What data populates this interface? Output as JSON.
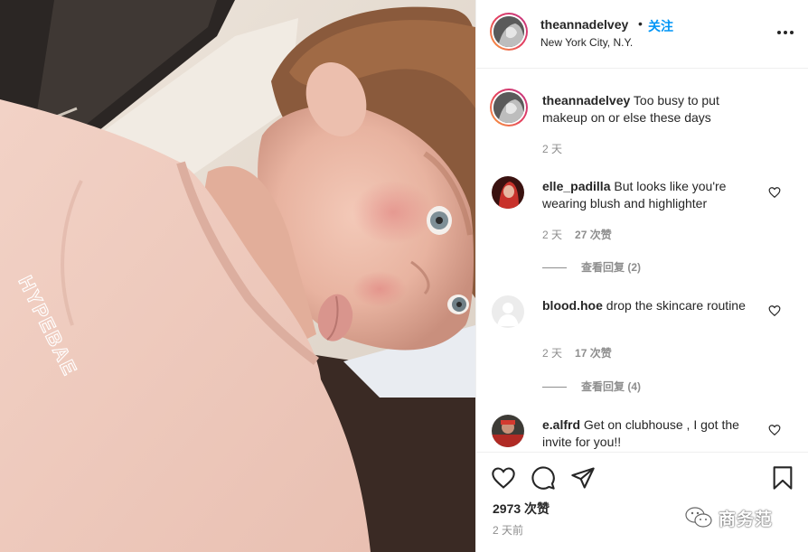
{
  "post": {
    "username": "theannadelvey",
    "separator": "•",
    "follow_label": "关注",
    "location": "New York City, N.Y.",
    "more_icon": "more-horizontal-icon",
    "shirt_text": "HYPEBAE"
  },
  "caption": {
    "username": "theannadelvey",
    "text": "Too busy to put makeup on or else these days",
    "time": "2 天"
  },
  "comments": [
    {
      "username": "elle_padilla",
      "text": "But looks like you're wearing blush and highlighter",
      "time": "2 天",
      "likes": "27 次赞",
      "replies": "查看回复 (2)"
    },
    {
      "username": "blood.hoe",
      "text": "drop the skincare routine",
      "time": "2 天",
      "likes": "17 次赞",
      "replies": "查看回复 (4)"
    },
    {
      "username": "e.alfrd",
      "text": "Get on clubhouse , I got the invite for you!!"
    }
  ],
  "actions": {
    "like_icon": "heart-icon",
    "comment_icon": "comment-icon",
    "share_icon": "send-icon",
    "save_icon": "bookmark-icon",
    "likes": "2973 次赞",
    "time": "2 天前"
  },
  "watermark": {
    "text": "商务范",
    "icon": "wechat-icon"
  },
  "colors": {
    "link_blue": "#0095f6",
    "text": "#262626",
    "muted": "#8e8e8e",
    "border": "#efefef"
  }
}
